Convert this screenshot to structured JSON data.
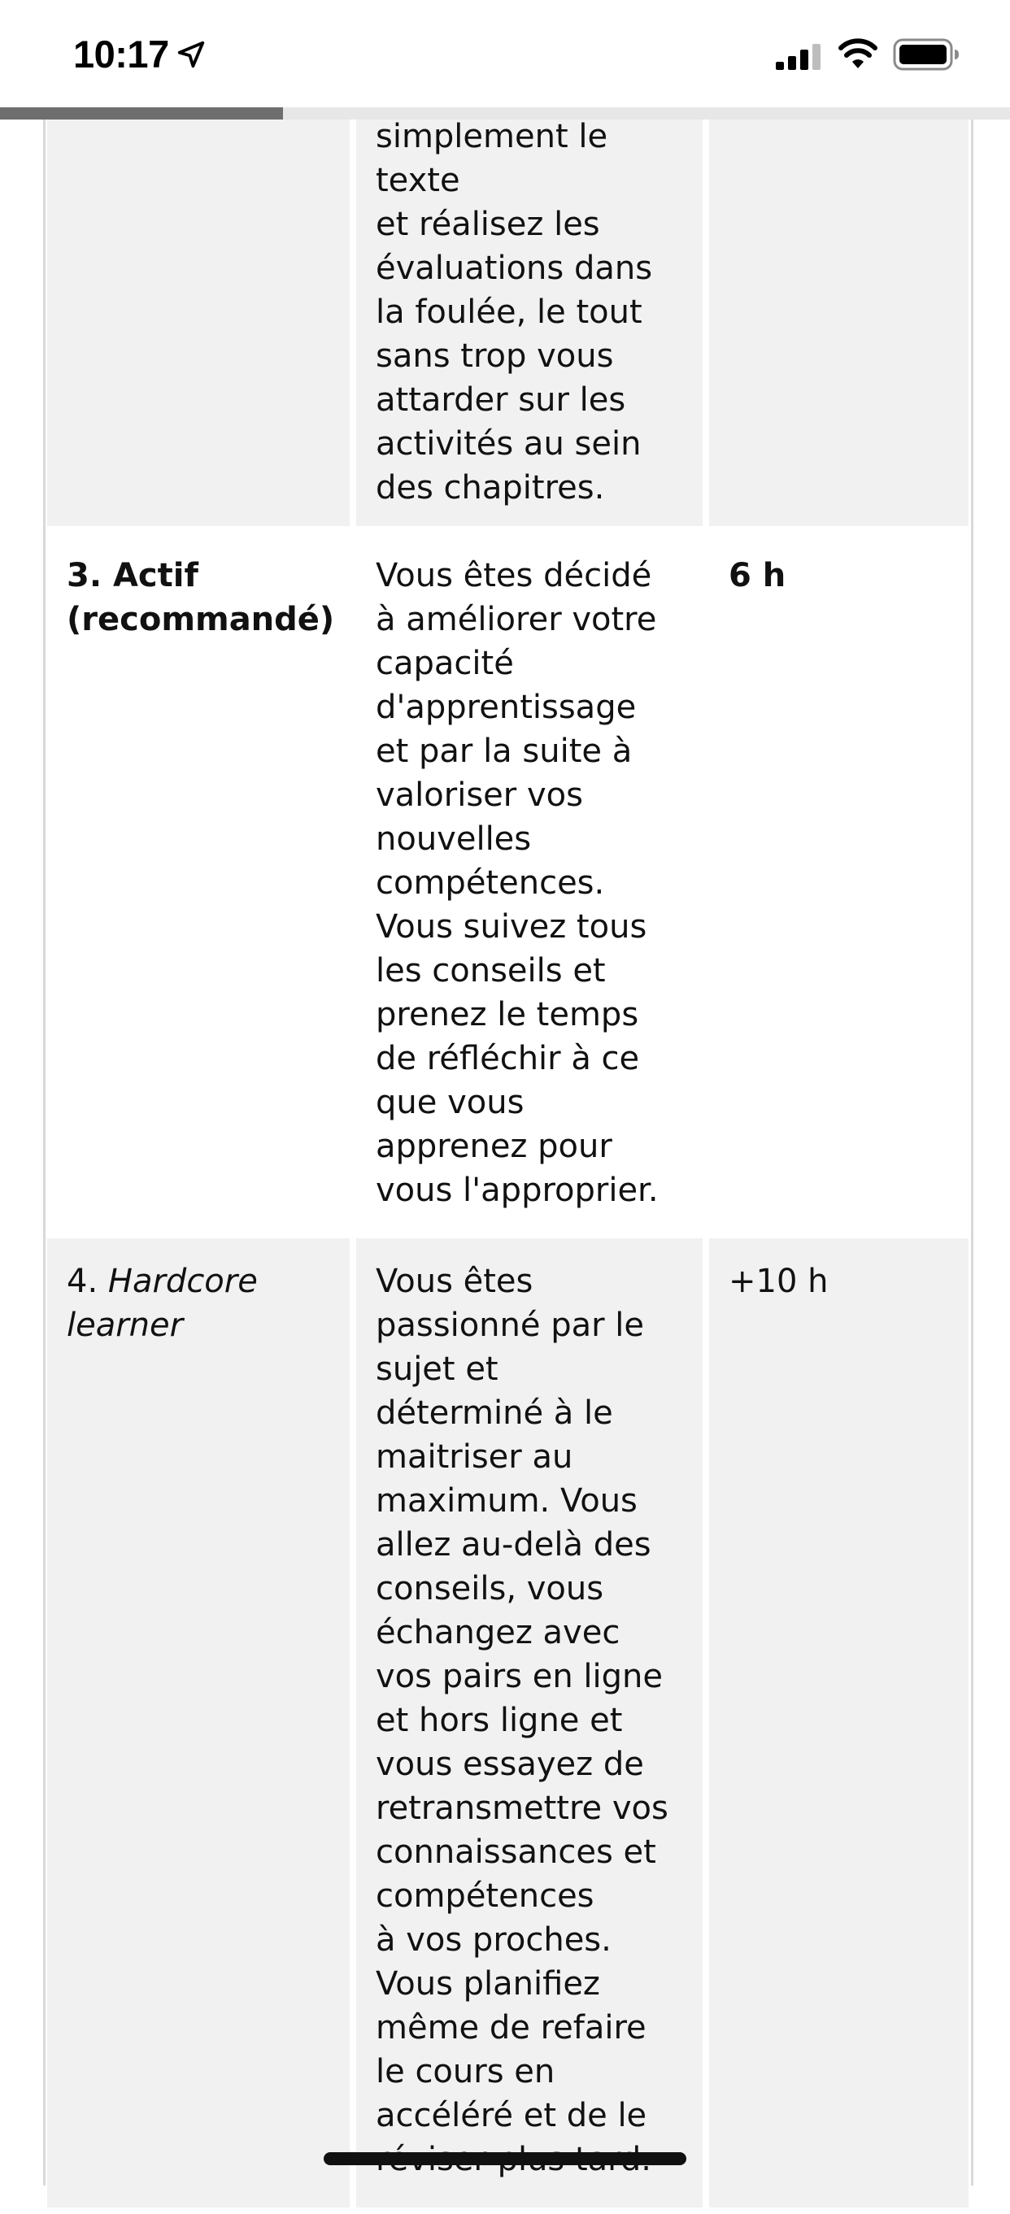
{
  "status_bar": {
    "time": "10:17",
    "icons": [
      "location-arrow-icon",
      "cellular-signal-icon",
      "wifi-icon",
      "battery-icon"
    ]
  },
  "reading_progress": {
    "fraction": 0.28,
    "fill_color": "#6e6e6e",
    "track_color": "#e7e7e7"
  },
  "table": {
    "rows": [
      {
        "level": "",
        "description": "simplement le\ntexte\net réalisez les\névaluations dans\nla foulée, le tout\nsans trop vous\nattarder sur les\nactivités au sein\ndes chapitres.",
        "time": ""
      },
      {
        "level": "3. Actif\n(recommandé)",
        "description": "Vous êtes décidé\nà améliorer votre\ncapacité\nd'apprentissage\net par la suite à\nvaloriser vos\nnouvelles\ncompétences.\nVous suivez tous\nles conseils et\nprenez le temps\nde réfléchir à ce\nque vous\napprenez pour\nvous l'approprier.",
        "time": "6 h"
      },
      {
        "level_number": "4.",
        "level_name": "Hardcore\nlearner",
        "description": "Vous êtes\npassionné par le\nsujet et\ndéterminé à le\nmaitriser au\nmaximum. Vous\nallez au-delà des\nconseils, vous\néchangez avec\nvos pairs en ligne\net hors ligne et\nvous essayez de\nretransmettre vos\nconnaissances et\ncompétences\nà vos proches.\nVous planifiez\nmême de refaire\nle cours en\naccéléré et de le\nréviser plus tard.",
        "time": "+10 h"
      }
    ]
  }
}
